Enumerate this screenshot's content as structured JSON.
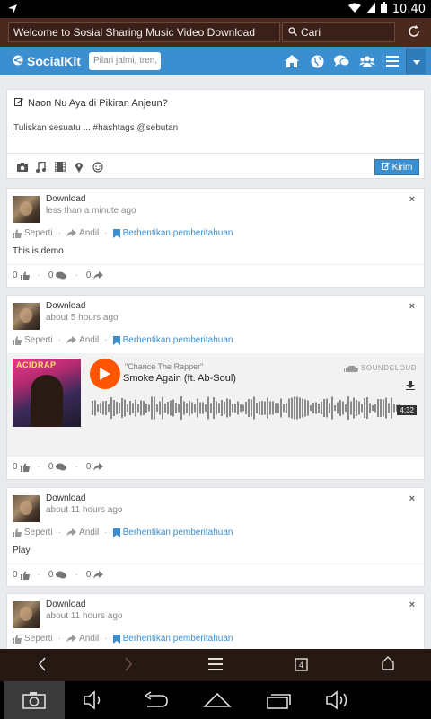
{
  "status": {
    "time": "10.40"
  },
  "browser": {
    "url_text": "Welcome to Sosial Sharing Music Video Download",
    "search_label": "Cari"
  },
  "app": {
    "brand": "SocialKit",
    "search_placeholder": "Pilari jalmi, tren,"
  },
  "composer": {
    "title": "Naon Nu Aya di Pikiran Anjeun?",
    "placeholder": "Tuliskan sesuatu ... #hashtags @sebutan",
    "send_label": "Kirim"
  },
  "labels": {
    "like": "Seperti",
    "share": "Andil",
    "unfollow": "Berhentikan pemberitahuan",
    "close": "×"
  },
  "posts": [
    {
      "author": "Download",
      "time": "less than a minute ago",
      "text": "This is demo",
      "likes": "0",
      "comments": "0",
      "shares": "0"
    },
    {
      "author": "Download",
      "time": "about 5 hours ago",
      "likes": "0",
      "comments": "0",
      "shares": "0",
      "embed": {
        "artist": "\"Chance The Rapper\"",
        "track": "Smoke Again (ft. Ab-Soul)",
        "provider": "SOUNDCLOUD",
        "duration": "4:32",
        "album_art_text": "ACIDRAP"
      }
    },
    {
      "author": "Download",
      "time": "about 11 hours ago",
      "text": "Play",
      "likes": "0",
      "comments": "0",
      "shares": "0"
    },
    {
      "author": "Download",
      "time": "about 11 hours ago"
    }
  ],
  "navbar": {
    "tabs_count": "4"
  }
}
